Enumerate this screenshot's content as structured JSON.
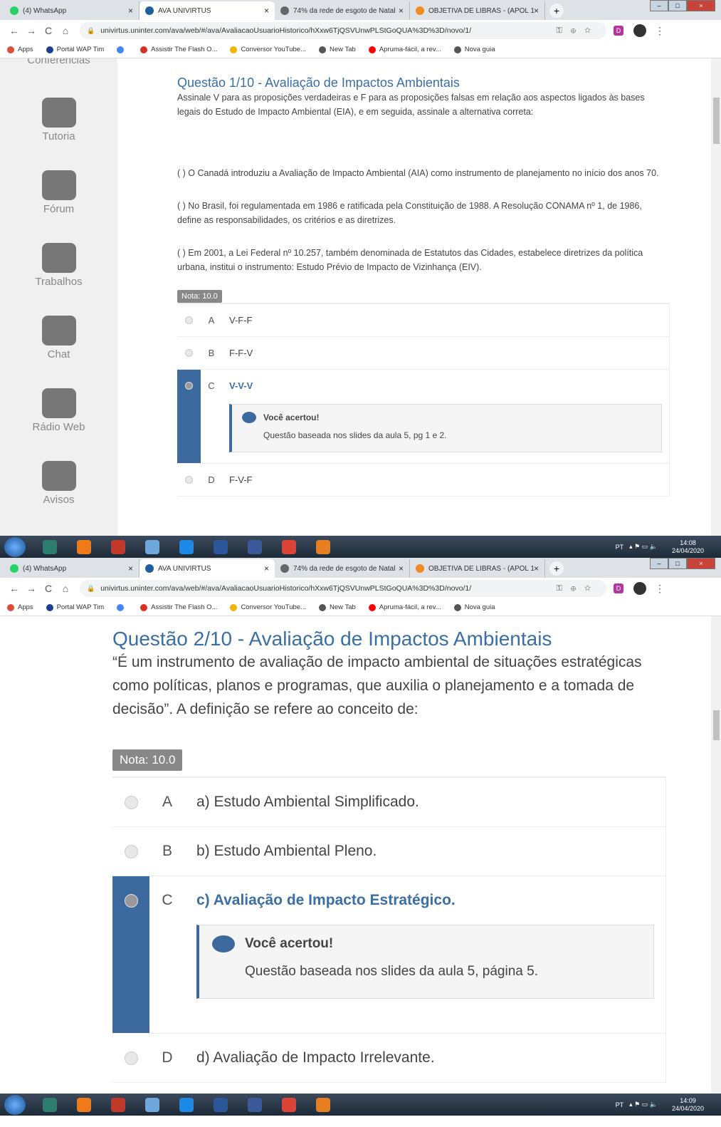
{
  "browser": {
    "tabs": [
      {
        "title": "(4) WhatsApp",
        "icon": "whatsapp-icon",
        "color": "#25d366",
        "active": false
      },
      {
        "title": "AVA UNIVIRTUS",
        "icon": "univirtus-icon",
        "color": "#1f5f9e",
        "active": true
      },
      {
        "title": "74% da rede de esgoto de Natal",
        "icon": "globe-icon",
        "color": "#666666",
        "active": false
      },
      {
        "title": "OBJETIVA DE LIBRAS - (APOL 1",
        "icon": "ava-icon",
        "color": "#f08a24",
        "active": false
      }
    ],
    "url": "univirtus.uninter.com/ava/web/#/ava/AvaliacaoUsuarioHistorico/hXxw6TjQSVUnwPLStGoQUA%3D%3D/novo/1/",
    "extension_label": "D",
    "bookmarks": [
      {
        "label": "Apps",
        "color": "#e04b3a"
      },
      {
        "label": "Portal WAP Tim",
        "color": "#1d3f8f"
      },
      {
        "label": "",
        "color": "#4285f4",
        "glyph": "G"
      },
      {
        "label": "Assistir The Flash O...",
        "color": "#d93025",
        "glyph": "M"
      },
      {
        "label": "Conversor YouTube...",
        "color": "#f4b400"
      },
      {
        "label": "New Tab",
        "color": "#555555"
      },
      {
        "label": "Apruma-fácil, a rev...",
        "color": "#ff0000"
      },
      {
        "label": "Nova guia",
        "color": "#555555"
      }
    ]
  },
  "taskbar": {
    "lang": "PT",
    "date": "24/04/2020",
    "times": [
      "14:08",
      "14:09"
    ],
    "apps": [
      {
        "name": "app-arrow",
        "color": "#2d7d6f"
      },
      {
        "name": "media-player",
        "color": "#ef7a1a"
      },
      {
        "name": "app-ring",
        "color": "#c0392b"
      },
      {
        "name": "document-viewer",
        "color": "#6fa8dc"
      },
      {
        "name": "internet-explorer",
        "color": "#1e88e5"
      },
      {
        "name": "word",
        "color": "#2b579a"
      },
      {
        "name": "facebook",
        "color": "#3b5998"
      },
      {
        "name": "chrome",
        "color": "#db4437"
      },
      {
        "name": "glove-app",
        "color": "#e67e22"
      }
    ]
  },
  "sidebar": [
    {
      "label": "Conferências",
      "icon": "video-conference-icon"
    },
    {
      "label": "Tutoria",
      "icon": "graduate-icon"
    },
    {
      "label": "Fórum",
      "icon": "quote-bubble-icon"
    },
    {
      "label": "Trabalhos",
      "icon": "wheelbarrow-icon"
    },
    {
      "label": "Chat",
      "icon": "chat-bubbles-icon"
    },
    {
      "label": "Rádio Web",
      "icon": "microphone-icon"
    },
    {
      "label": "Avisos",
      "icon": "envelope-icon"
    }
  ],
  "q1": {
    "title": "Questão 1/10 - Avaliação de Impactos Ambientais",
    "text": "Assinale V para as proposições verdadeiras e F para as proposições falsas em relação aos aspectos ligados às bases legais do Estudo de Impacto Ambiental (EIA), e em seguida, assinale a alternativa correta:",
    "props": [
      "( ) O Canadá introduziu a Avaliação de Impacto Ambiental (AIA) como instrumento de planejamento no início dos anos 70.",
      "( ) No Brasil, foi regulamentada em 1986 e ratificada pela Constituição de 1988. A Resolução CONAMA nº  1, de 1986, define as responsabilidades, os critérios e as diretrizes.",
      "( ) Em 2001, a Lei Federal nº 10.257, também denominada de Estatutos das Cidades, estabelece diretrizes da política urbana, institui o instrumento: Estudo Prévio de Impacto de Vizinhança (EIV)."
    ],
    "nota": "Nota: 10.0",
    "options": [
      {
        "letter": "A",
        "text": "V-F-F",
        "selected": false
      },
      {
        "letter": "B",
        "text": "F-F-V",
        "selected": false
      },
      {
        "letter": "C",
        "text": "V-V-V",
        "selected": true,
        "feedback_title": "Você acertou!",
        "feedback_text": "Questão baseada nos slides da aula 5, pg 1 e 2."
      },
      {
        "letter": "D",
        "text": "F-V-F",
        "selected": false
      }
    ]
  },
  "q2": {
    "title": "Questão 2/10 - Avaliação de Impactos Ambientais",
    "text": "“É um instrumento de avaliação de impacto ambiental de situações estratégicas como políticas, planos e programas, que auxilia o planejamento e a tomada de decisão”. A definição se refere ao conceito de:",
    "nota": "Nota: 10.0",
    "options": [
      {
        "letter": "A",
        "text": "a) Estudo Ambiental Simplificado.",
        "selected": false
      },
      {
        "letter": "B",
        "text": "b) Estudo Ambiental Pleno.",
        "selected": false
      },
      {
        "letter": "C",
        "text": "c) Avaliação de Impacto Estratégico.",
        "selected": true,
        "feedback_title": "Você acertou!",
        "feedback_text": "Questão baseada nos slides da aula 5, página 5."
      },
      {
        "letter": "D",
        "text": "d) Avaliação de Impacto Irrelevante.",
        "selected": false
      }
    ]
  },
  "colors": {
    "accent": "#3a6ea5",
    "selected_strip": "#3d6a9e",
    "sidebar_bg": "#f0f0f0"
  }
}
